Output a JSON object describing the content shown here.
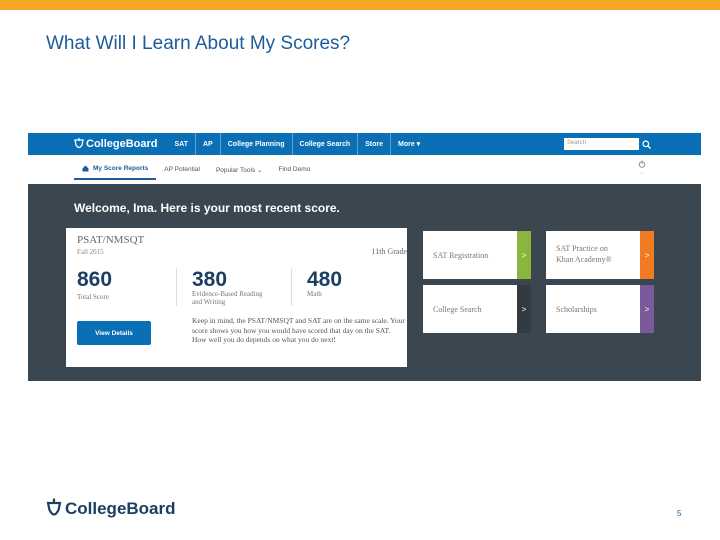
{
  "slide": {
    "title": "What Will I Learn About My Scores?",
    "page_number": "5",
    "footer_brand": "CollegeBoard",
    "accent_color": "#f5a623",
    "title_color": "#1d5c9b"
  },
  "site": {
    "brand": "CollegeBoard",
    "nav": [
      "SAT",
      "AP",
      "College Planning",
      "College Search",
      "Store",
      "More ▾"
    ],
    "search_placeholder": "Search",
    "subnav": [
      "My Score Reports",
      "AP Potential",
      "Popular Tools ⌄",
      "Find Demo"
    ],
    "logout": "←",
    "welcome": "Welcome, Ima. Here is your most recent score."
  },
  "score_card": {
    "exam": "PSAT/NMSQT",
    "term": "Fall 2015",
    "grade": "11th Grade",
    "total": {
      "value": "860",
      "label": "Total Score"
    },
    "section1": {
      "value": "380",
      "label_line1": "Evidence-Based Reading",
      "label_line2": "and Writing"
    },
    "section2": {
      "value": "480",
      "label": "Math"
    },
    "note": "Keep in mind, the PSAT/NMSQT and SAT are on the same scale. Your score shows you how you would have scored that day on the SAT. How well you do depends on what you do next!",
    "button": "View Details"
  },
  "tiles": [
    {
      "label_line1": "SAT Registration",
      "label_line2": "",
      "color": "#8bb53c"
    },
    {
      "label_line1": "SAT Practice on",
      "label_line2": "Khan Academy®",
      "color": "#f07b22"
    },
    {
      "label_line1": "College Search",
      "label_line2": "",
      "color": "#333a40"
    },
    {
      "label_line1": "Scholarships",
      "label_line2": "",
      "color": "#7b5a9c"
    }
  ]
}
